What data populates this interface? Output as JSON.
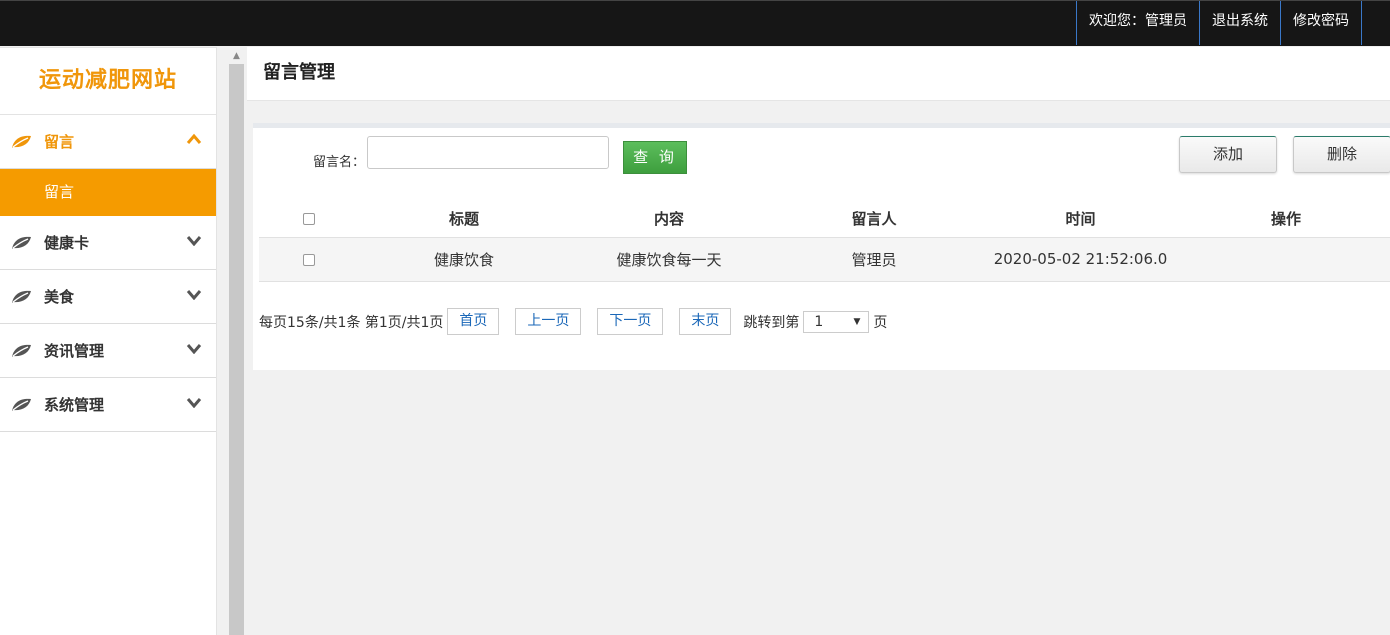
{
  "topbar": {
    "welcome": "欢迎您：管理员",
    "logout": "退出系统",
    "change_password": "修改密码"
  },
  "sidebar": {
    "logo": "运动减肥网站",
    "menus": [
      {
        "label": "留言",
        "expanded": true,
        "sub": [
          {
            "label": "留言"
          }
        ]
      },
      {
        "label": "健康卡"
      },
      {
        "label": "美食"
      },
      {
        "label": "资讯管理"
      },
      {
        "label": "系统管理"
      }
    ]
  },
  "page": {
    "title": "留言管理"
  },
  "search": {
    "label": "留言名：",
    "value": "",
    "query_button": "查 询",
    "add_button": "添加",
    "delete_button": "删除"
  },
  "table": {
    "headers": [
      "标题",
      "内容",
      "留言人",
      "时间",
      "操作"
    ],
    "rows": [
      [
        "健康饮食",
        "健康饮食每一天",
        "管理员",
        "2020-05-02 21:52:06.0",
        ""
      ]
    ]
  },
  "pager": {
    "info": "每页15条/共1条 第1页/共1页",
    "first": "首页",
    "prev": "上一页",
    "next": "下一页",
    "last": "末页",
    "jump_label": "跳转到第",
    "jump_value": "1",
    "page_unit": "页"
  },
  "colors": {
    "accent": "#f59b00",
    "topbar": "#161616",
    "query_button": "#4caf50",
    "link": "#1a67b8"
  }
}
